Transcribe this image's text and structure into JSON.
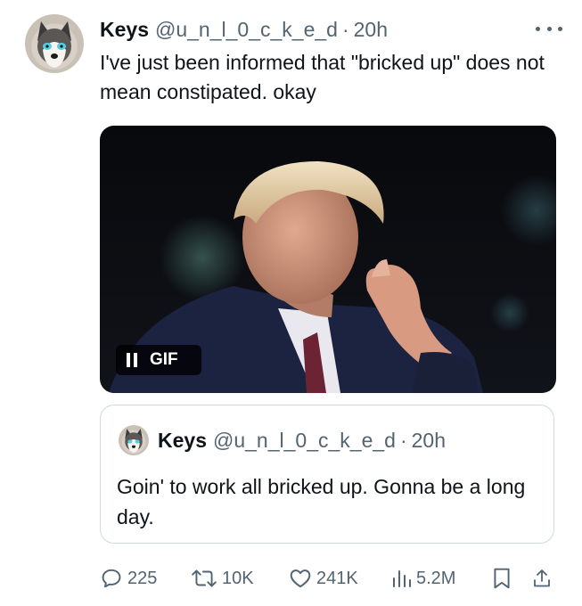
{
  "tweet": {
    "author_name": "Keys",
    "author_handle": "@u_n_l_0_c_k_e_d",
    "separator": "·",
    "time": "20h",
    "text": "I've just been informed that \"bricked up\" does not mean constipated. okay",
    "media_badge": "GIF"
  },
  "quoted_tweet": {
    "author_name": "Keys",
    "author_handle": "@u_n_l_0_c_k_e_d",
    "separator": "·",
    "time": "20h",
    "text": "Goin' to work all bricked up. Gonna be a long day."
  },
  "actions": {
    "replies": "225",
    "reposts": "10K",
    "likes": "241K",
    "views": "5.2M"
  },
  "icons": {
    "more": "more-horizontal-icon",
    "reply": "reply-bubble-icon",
    "repost": "repost-arrows-icon",
    "like": "heart-icon",
    "views": "bar-chart-icon",
    "bookmark": "bookmark-icon",
    "share": "share-upload-icon",
    "pause": "pause-icon"
  },
  "colors": {
    "text_primary": "#0f1419",
    "text_secondary": "#536471",
    "border": "#cfd9de"
  }
}
